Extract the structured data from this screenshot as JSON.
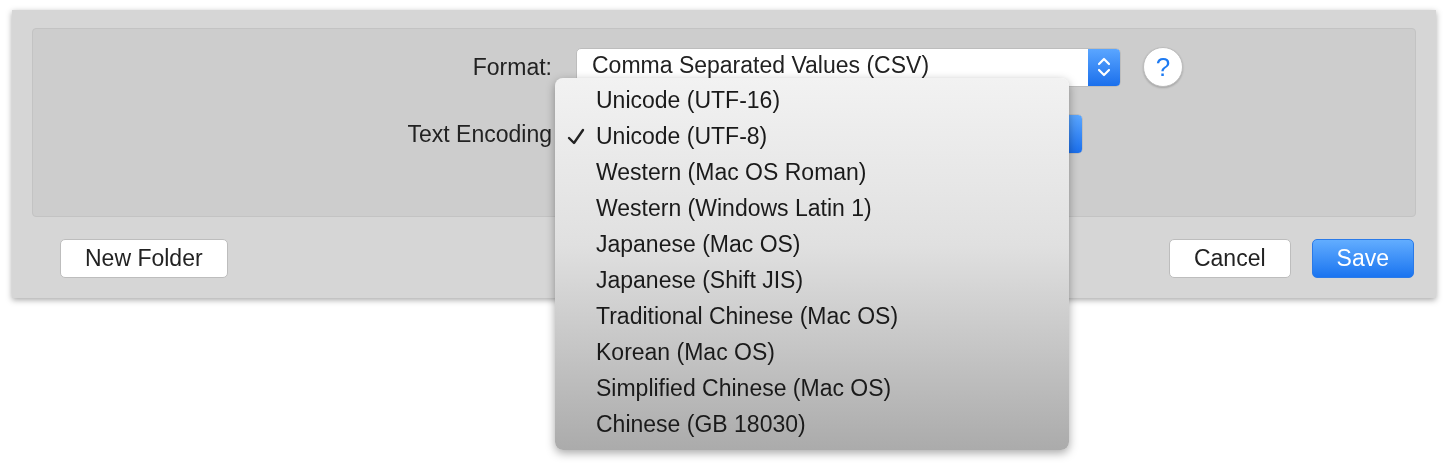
{
  "format": {
    "label": "Format:",
    "value": "Comma Separated Values (CSV)",
    "help": "?"
  },
  "encoding": {
    "label": "Text Encoding",
    "menu": [
      {
        "label": "Unicode (UTF-16)",
        "checked": false
      },
      {
        "label": "Unicode (UTF-8)",
        "checked": true
      },
      {
        "label": "Western (Mac OS Roman)",
        "checked": false
      },
      {
        "label": "Western (Windows Latin 1)",
        "checked": false
      },
      {
        "label": "Japanese (Mac OS)",
        "checked": false
      },
      {
        "label": "Japanese (Shift JIS)",
        "checked": false
      },
      {
        "label": "Traditional Chinese (Mac OS)",
        "checked": false
      },
      {
        "label": "Korean (Mac OS)",
        "checked": false
      },
      {
        "label": "Simplified Chinese (Mac OS)",
        "checked": false
      },
      {
        "label": "Chinese (GB 18030)",
        "checked": false
      }
    ]
  },
  "buttons": [
    {
      "label": "New Folder",
      "kind": "secondary"
    },
    {
      "label": "Cancel",
      "kind": "secondary"
    },
    {
      "label": "Save",
      "kind": "primary"
    }
  ]
}
